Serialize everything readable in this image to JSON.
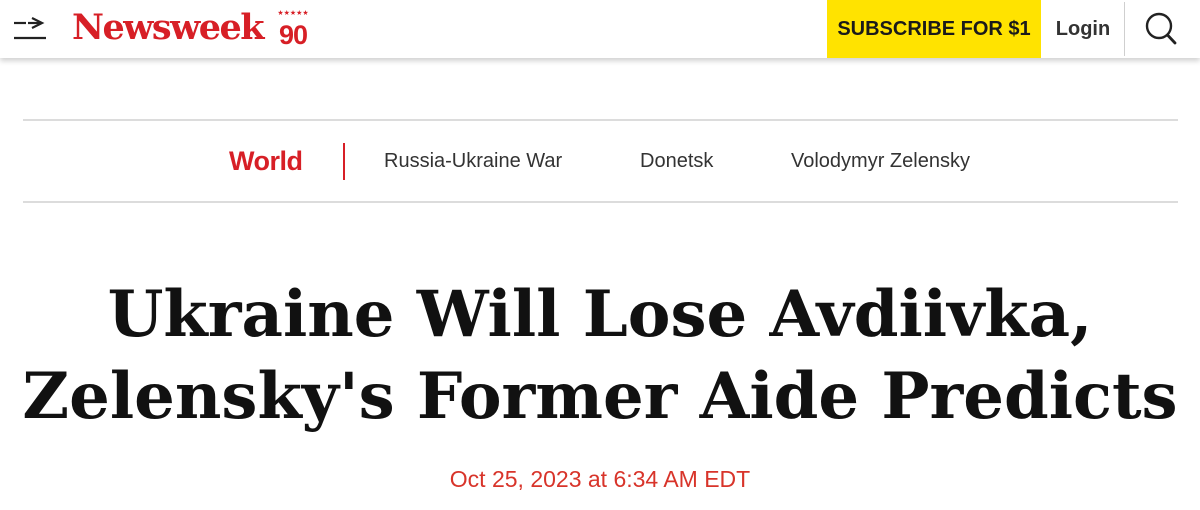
{
  "header": {
    "logo": {
      "brand": "Newsweek",
      "anniversary": "90",
      "stars": "★★★★★"
    },
    "subscribe_label": "SUBSCRIBE FOR $1",
    "login_label": "Login",
    "icons": {
      "menu": "menu-arrow-icon",
      "search": "search-icon"
    }
  },
  "topic_nav": {
    "section": "World",
    "tags": [
      "Russia-Ukraine War",
      "Donetsk",
      "Volodymyr Zelensky"
    ]
  },
  "article": {
    "headline_line1": "Ukraine Will Lose Avdiivka,",
    "headline_line2": "Zelensky's Former Aide Predicts",
    "date": "Oct 25, 2023 at 6:34 AM EDT"
  },
  "colors": {
    "brand_red": "#d71f26",
    "subscribe_yellow": "#ffe300",
    "date_red": "#d8342a"
  }
}
